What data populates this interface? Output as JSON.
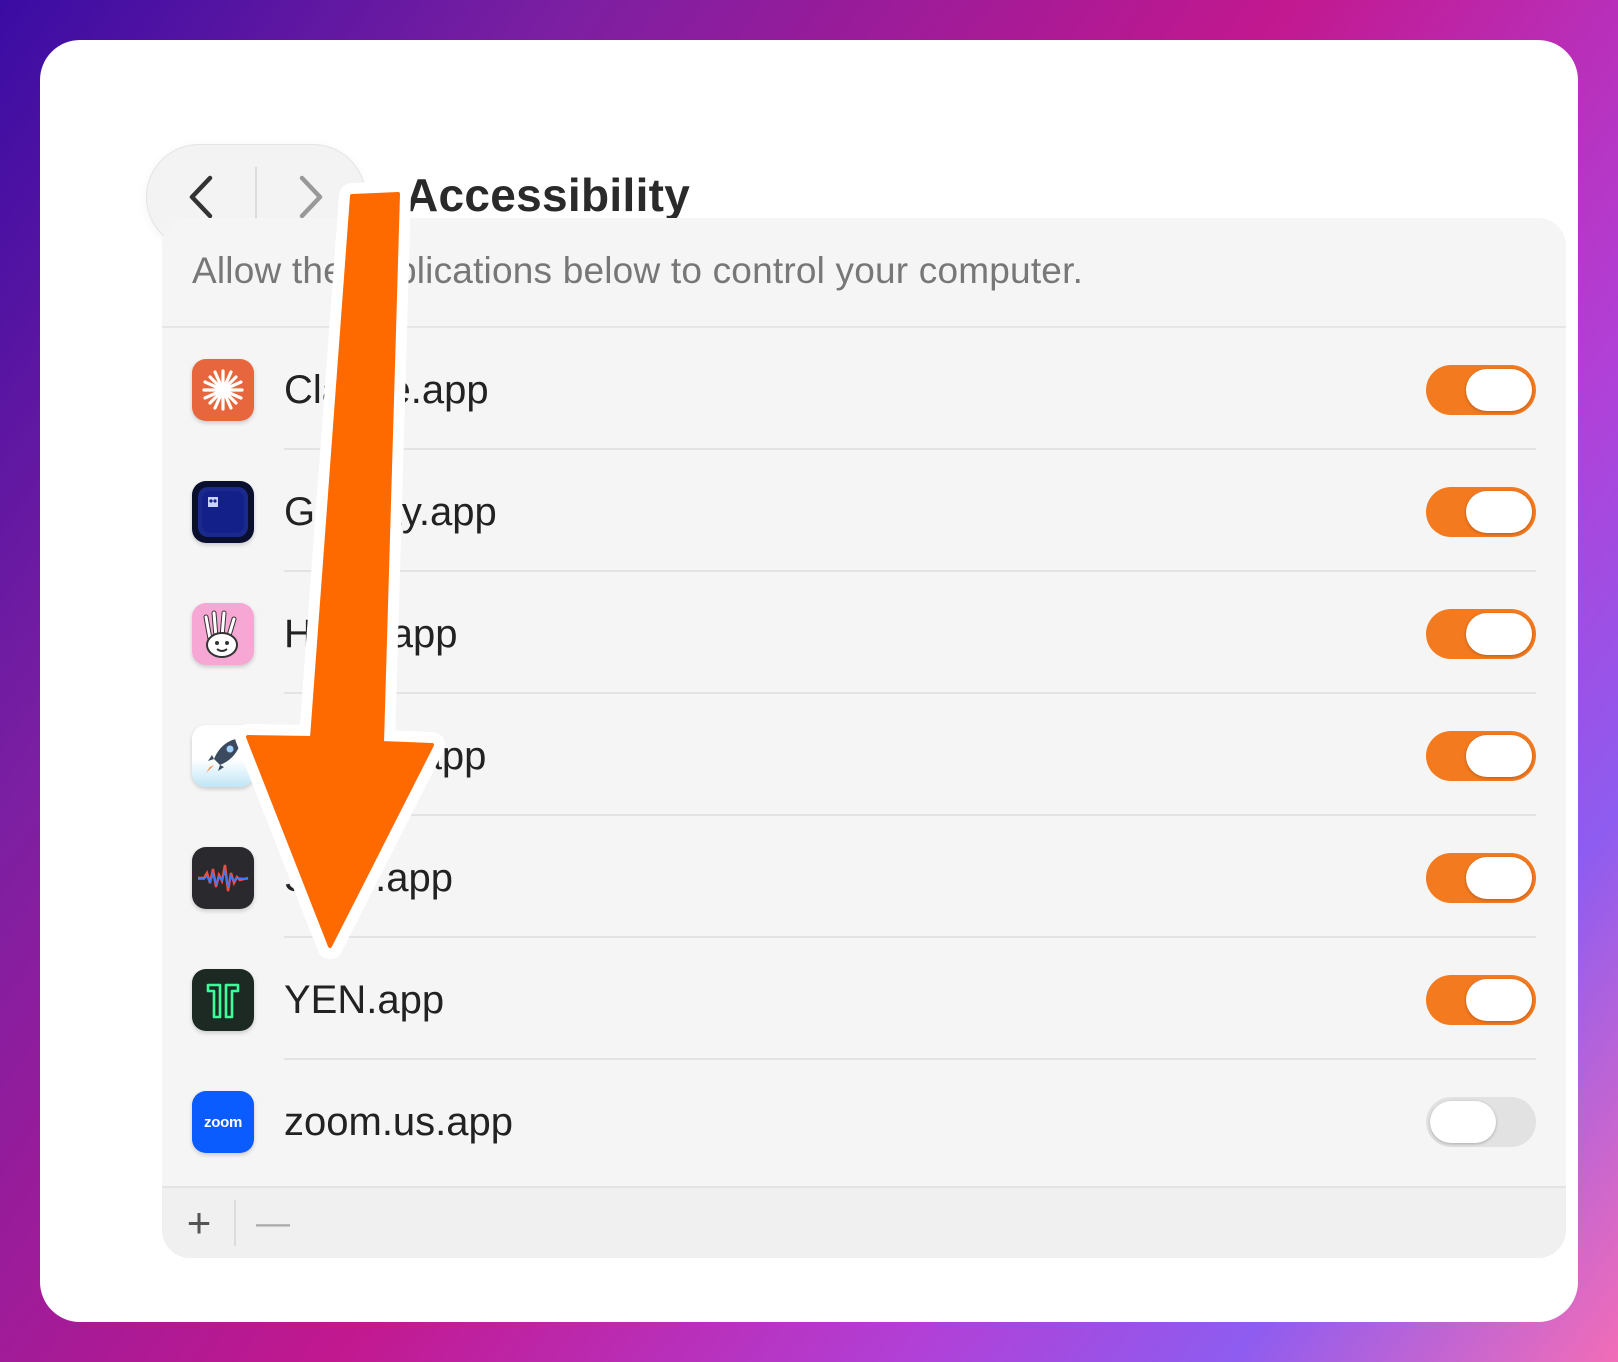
{
  "window": {
    "title": "Accessibility",
    "description": "Allow the applications below to control your computer."
  },
  "nav": {
    "back_icon": "chevron-left-icon",
    "forward_icon": "chevron-right-icon"
  },
  "apps": [
    {
      "name": "Claude.app",
      "icon": "claude-icon",
      "enabled": true
    },
    {
      "name": "Ghostty.app",
      "icon": "ghost-icon",
      "enabled": true
    },
    {
      "name": "Hand.app",
      "icon": "hand-icon",
      "enabled": true
    },
    {
      "name": "Rocket.app",
      "icon": "rocket-icon",
      "enabled": true
    },
    {
      "name": "Stats.app",
      "icon": "waveform-icon",
      "enabled": true
    },
    {
      "name": "YEN.app",
      "icon": "yen-icon",
      "enabled": true
    },
    {
      "name": "zoom.us.app",
      "icon": "zoom-icon",
      "enabled": false,
      "icon_text": "zoom"
    }
  ],
  "footer": {
    "add_label": "+",
    "remove_label": "—"
  },
  "colors": {
    "accent": "#f47a1f",
    "arrow": "#ff6a00"
  }
}
